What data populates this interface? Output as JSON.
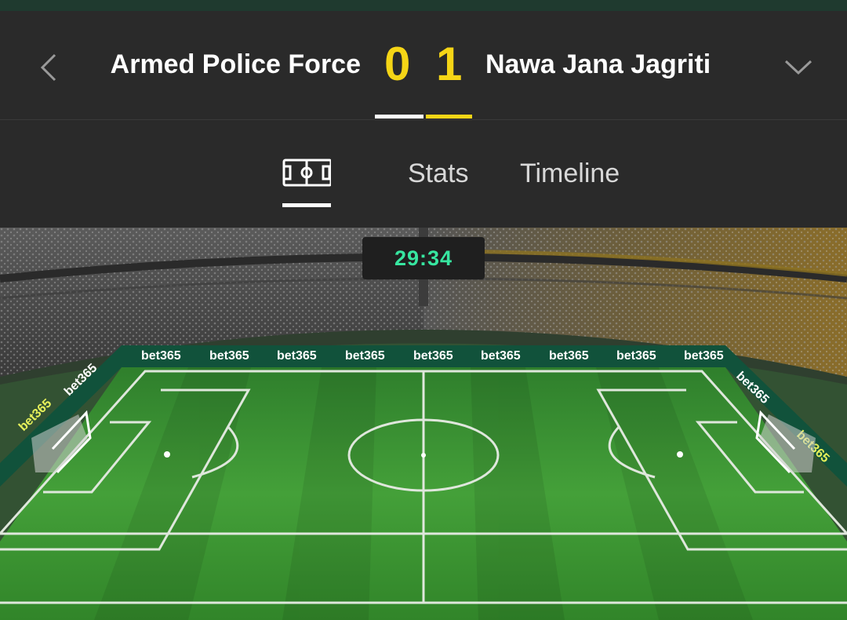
{
  "header": {
    "home_team": "Armed Police Force",
    "away_team": "Nawa Jana Jagriti",
    "home_score": "0",
    "away_score": "1"
  },
  "tabs": [
    {
      "label": "",
      "icon": "pitch-icon",
      "active": true
    },
    {
      "label": "Stats",
      "active": false
    },
    {
      "label": "Timeline",
      "active": false
    }
  ],
  "match": {
    "clock": "29:34",
    "sponsor_text": "bet365"
  },
  "colors": {
    "score": "#f5d516",
    "clock": "#37e6a0",
    "pitch": "#3f9a35",
    "board": "#11523b"
  }
}
